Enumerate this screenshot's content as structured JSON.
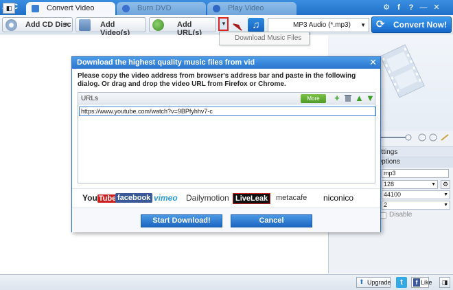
{
  "app": {
    "logo": "AVC",
    "tabs": [
      {
        "label": "Convert Video",
        "active": true
      },
      {
        "label": "Burn DVD",
        "active": false
      },
      {
        "label": "Play Video",
        "active": false
      }
    ],
    "window_buttons": {
      "settings": "⚙",
      "social": "f",
      "help": "?",
      "minimize": "—",
      "close": "✕"
    }
  },
  "toolbar": {
    "add_cd": "Add CD Disc",
    "add_videos": "Add Video(s)",
    "add_urls": "Add URL(s)",
    "format": "MP3 Audio (*.mp3)",
    "convert": "Convert Now!"
  },
  "dropdown_menu": {
    "item": "Download Music Files"
  },
  "right_panel": {
    "settings_title": "Basic Settings",
    "audio_options": "Audio Options",
    "fields": [
      {
        "value": "mp3"
      },
      {
        "value": "128"
      },
      {
        "value": "44100"
      },
      {
        "value": "2"
      }
    ],
    "disable_label": "Disable"
  },
  "dialog": {
    "title": "Download the highest quality music files from vid",
    "description": "Please copy the video address from browser's address bar and paste in the following dialog. Or drag and drop the video URL from Firefox or Chrome.",
    "urls_header": "URLs",
    "more_sites": "More Sites",
    "url_value": "https://www.youtube.com/watch?v=9BPfyhhv7-c",
    "sites": {
      "youtube_a": "You",
      "youtube_b": "Tube",
      "facebook": "facebook",
      "vimeo": "vimeo",
      "dailymotion": "Dailymotion",
      "liveleak": "LiveLeak",
      "metacafe": "metacafe",
      "niconico": "niconico"
    },
    "start_button": "Start Download!",
    "cancel_button": "Cancel"
  },
  "status_bar": {
    "upgrade": "Upgrade",
    "twitter": "t",
    "facebook_f": "f",
    "like": "Like"
  },
  "colors": {
    "accent": "#2474d0",
    "highlight": "#dd2222",
    "more_sites": "#5ea62f"
  }
}
